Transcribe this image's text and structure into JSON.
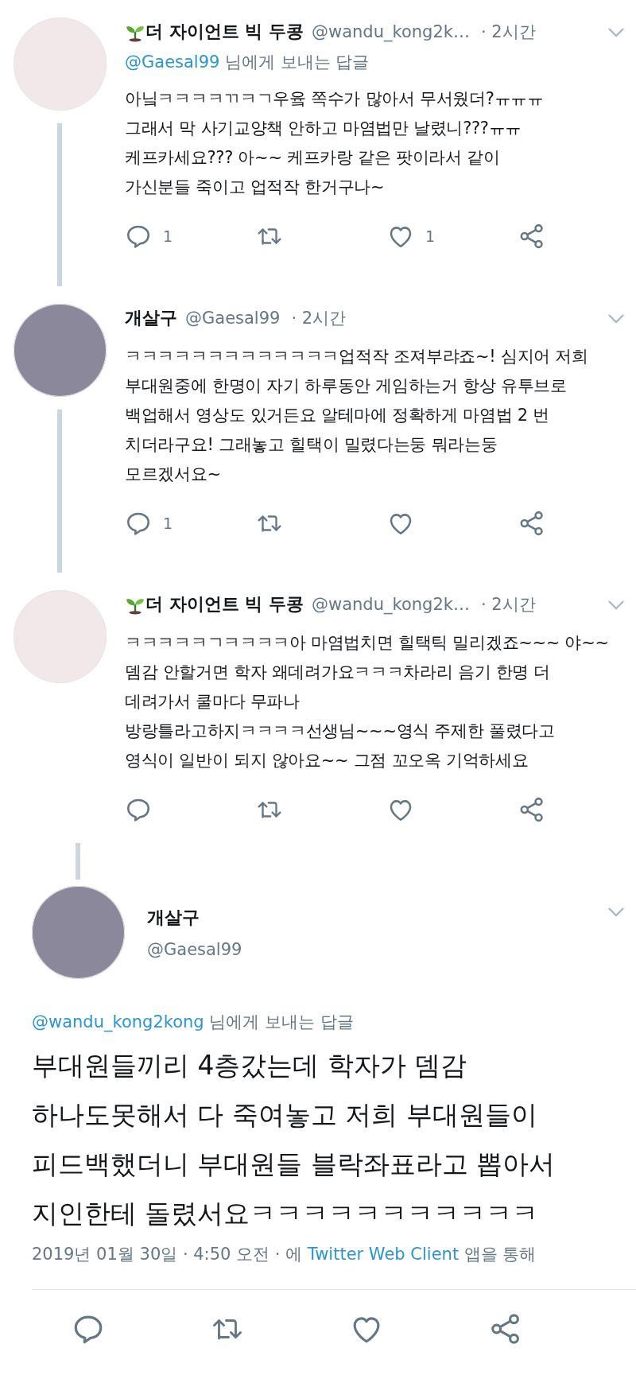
{
  "replies": [
    {
      "author": {
        "name": "더 자이언트 빅 두콩",
        "has_seedling": true,
        "handle": "@wandu_kong2k…",
        "avatar": {
          "color": "#f2e8ea"
        }
      },
      "time": "· 2시간",
      "reply_to": {
        "handle": "@Gaesal99",
        "suffix": "님에게 보내는 답글"
      },
      "text": "아닠ㅋㅋㅋㅋㄲㅋㄱ우윸 쪽수가 많아서 무서웠더?ㅠㅠㅠ\n그래서 막 사기교양책 안하고 마염법만 날렸니???ㅠㅠ\n케프카세요??? 아~~ 케프카랑 같은 팟이라서 같이\n가신분들 죽이고 업적작 한거구나~",
      "reply_count": "1",
      "like_count": "1",
      "connected_below": true
    },
    {
      "author": {
        "name": "개살구",
        "has_seedling": false,
        "handle": "@Gaesal99",
        "avatar": {
          "color": "#8c889c"
        }
      },
      "time": "· 2시간",
      "text": "ㅋㅋㅋㅋㅋㅋㅋㅋㅋㅋㅋㅋㅋ업적작 조져부랴죠~! 심지어 저희\n부대원중에 한명이 자기 하루동안 게임하는거 항상 유투브로\n백업해서 영상도 있거든요 알테마에 정확하게 마염법 2 번\n치더라구요! 그래놓고 힐택이 밀렸다는둥 뭐라는둥\n모르겠서요~",
      "reply_count": "1",
      "connected_below": true
    },
    {
      "author": {
        "name": "더 자이언트 빅 두콩",
        "has_seedling": true,
        "handle": "@wandu_kong2k…",
        "avatar": {
          "color": "#f2e8ea"
        }
      },
      "time": "· 2시간",
      "text": "ㅋㅋㅋㅋㅋㄱㅋㅋㅋㅋ아 마염법치면 힐택틱 밀리겠죠~~~ 야~~\n뎀감 안할거면 학자 왜데려가요ㅋㅋㅋ차라리 음기 한명 더\n데려가서 쿨마다 무파나\n방랑틀라고하지ㅋㅋㅋㅋ선생님~~~영식 주제한 풀렸다고\n영식이 일반이 되지 않아요~~ 그점 꼬오옥 기억하세요",
      "connected_below": false
    }
  ],
  "main_tweet": {
    "connected_above": true,
    "author": {
      "name": "개살구",
      "handle": "@Gaesal99",
      "avatar": {
        "color": "#8c889c"
      }
    },
    "reply_to": {
      "handle": "@wandu_kong2kong",
      "suffix": "님에게 보내는 답글"
    },
    "text": "부대원들끼리 4층갔는데 학자가 뎀감\n하나도못해서 다 죽여놓고 저희 부대원들이\n피드백했더니 부대원들 블락좌표라고 뽑아서\n지인한테 돌렸서요ㅋㅋㅋㅋㅋㅋㅋㅋㅋㅋㅋ",
    "date": "2019년 01월 30일 · 4:50 오전 · 에",
    "source": "Twitter Web Client",
    "source_suffix": "앱을 통해"
  }
}
